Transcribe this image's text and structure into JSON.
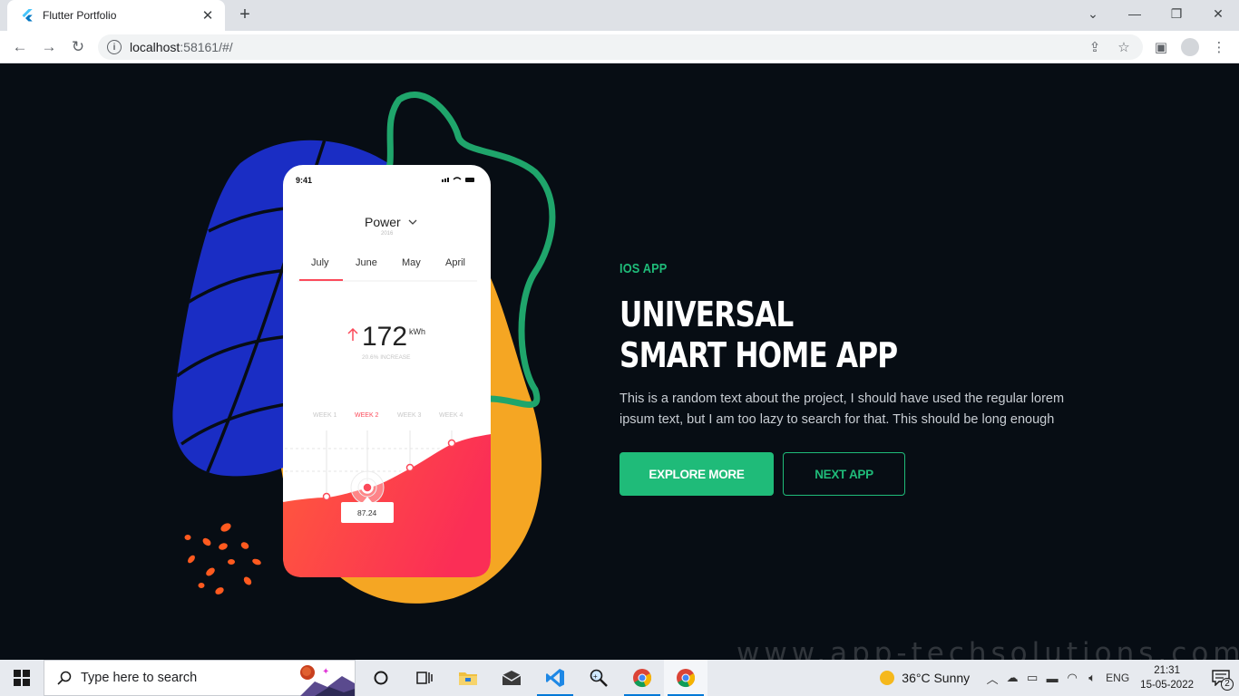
{
  "browser": {
    "tab_title": "Flutter Portfolio",
    "url_host": "localhost",
    "url_path": ":58161/#/",
    "icons": [
      "flutter-icon",
      "close-icon",
      "plus-icon",
      "back-icon",
      "forward-icon",
      "reload-icon",
      "info-icon",
      "share-icon",
      "star-icon",
      "sidebar-icon",
      "profile-icon",
      "menu-icon"
    ]
  },
  "hero": {
    "eyebrow": "IOS APP",
    "headline_line1": "UNIVERSAL",
    "headline_line2": "SMART HOME APP",
    "description": "This is a random text about the project, I should have used the regular lorem ipsum text, but I am too lazy to search for that. This should be long enough",
    "primary_button": "EXPLORE MORE",
    "secondary_button": "NEXT APP",
    "accent_color": "#1fbb79",
    "background_color": "#070d14"
  },
  "phone": {
    "time": "9:41",
    "title": "Power",
    "year": "2016",
    "months": [
      "July",
      "June",
      "May",
      "April"
    ],
    "selected_month": "July",
    "value": "172",
    "unit": "kWh",
    "subtitle": "20.6% INCREASE",
    "weeks": [
      "WEEK 1",
      "WEEK 2",
      "WEEK 3",
      "WEEK 4"
    ],
    "selected_week": "WEEK 2",
    "tooltip": "87.24"
  },
  "taskbar": {
    "search_placeholder": "Type here to search",
    "weather": "36°C  Sunny",
    "language": "ENG",
    "time": "21:31",
    "date": "15-05-2022",
    "notifications": "2"
  },
  "watermark": "www.app-techsolutions.com"
}
